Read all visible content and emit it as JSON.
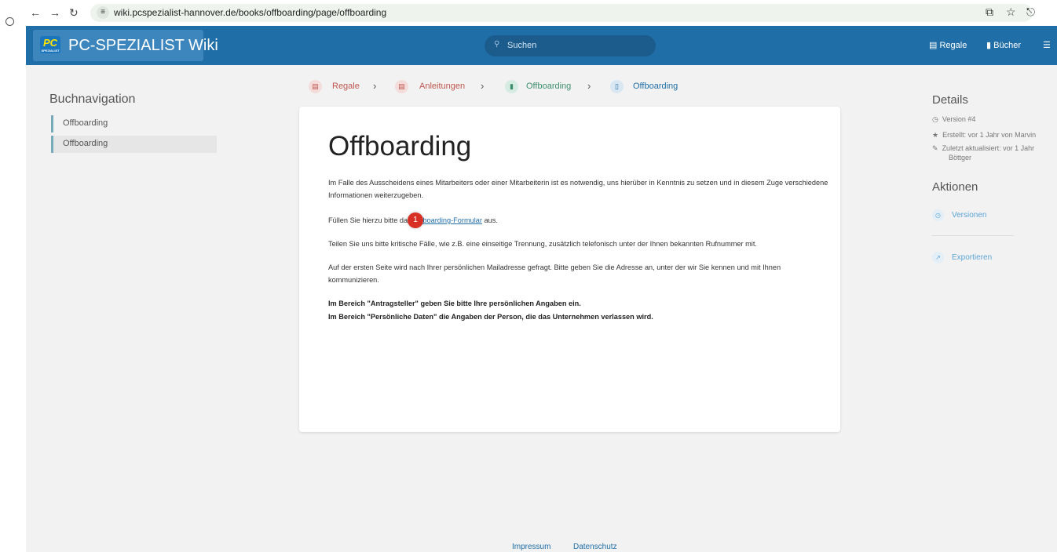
{
  "browser": {
    "back_icon": "arrow-left-icon",
    "forward_icon": "arrow-right-icon",
    "reload_icon": "reload-icon",
    "site_info_icon": "tune-icon",
    "url": "wiki.pcspezialist-hannover.de/books/offboarding/page/offboarding"
  },
  "header": {
    "logo_text": "PC",
    "logo_subtext": "SPEZIALIST",
    "brand_name": "PC-SPEZIALIST Wiki",
    "search_placeholder": "Suchen",
    "nav": [
      {
        "label": "Regale",
        "icon": "shelves-icon"
      },
      {
        "label": "Bücher",
        "icon": "books-icon"
      }
    ],
    "brand_color": "#206ea7"
  },
  "sidebar": {
    "title": "Buchnavigation",
    "items": [
      {
        "label": "Offboarding"
      },
      {
        "label": "Offboarding"
      }
    ]
  },
  "breadcrumbs": [
    {
      "label": "Regale",
      "icon": "shelves-icon",
      "color": "#c0564f"
    },
    {
      "label": "Anleitungen",
      "icon": "shelf-icon",
      "color": "#c0564f"
    },
    {
      "label": "Offboarding",
      "icon": "book-icon",
      "color": "#3e8e6e"
    },
    {
      "label": "Offboarding",
      "icon": "page-icon",
      "color": "#206ea7"
    }
  ],
  "page": {
    "title": "Offboarding",
    "p1": "Im Falle des Ausscheidens eines Mitarbeiters oder einer Mitarbeiterin ist es notwendig, uns hierüber in Kenntnis zu setzen und in diesem Zuge verschiedene Informationen weiterzugeben.",
    "p2_prefix": "Füllen Sie hierzu bitte das ",
    "p2_link": "Offboarding-Formular",
    "p2_suffix": " aus.",
    "p3": "Teilen Sie uns bitte kritische Fälle, wie z.B. eine einseitige Trennung, zusätzlich telefonisch unter der Ihnen bekannten Rufnummer mit.",
    "p4": "Auf der ersten Seite wird nach Ihrer persönlichen Mailadresse gefragt. Bitte geben Sie die Adresse an, unter der wir Sie kennen und mit Ihnen kommunizieren.",
    "bold1": "Im Bereich \"Antragsteller\" geben Sie bitte Ihre persönlichen Angaben ein.",
    "bold2": "Im Bereich \"Persönliche Daten\" die Angaben der Person, die das Unternehmen verlassen wird.",
    "marker": "1"
  },
  "details": {
    "title": "Details",
    "version": "Version #4",
    "created": "Erstellt: vor 1 Jahr von Marvin",
    "updated_line1": "Zuletzt aktualisiert: vor 1 Jahr",
    "updated_line2": "Böttger"
  },
  "actions": {
    "title": "Aktionen",
    "items": [
      {
        "label": "Versionen",
        "icon": "history-icon"
      },
      {
        "label": "Exportieren",
        "icon": "export-icon"
      }
    ]
  },
  "footer": {
    "links": [
      "Impressum",
      "Datenschutz"
    ]
  }
}
